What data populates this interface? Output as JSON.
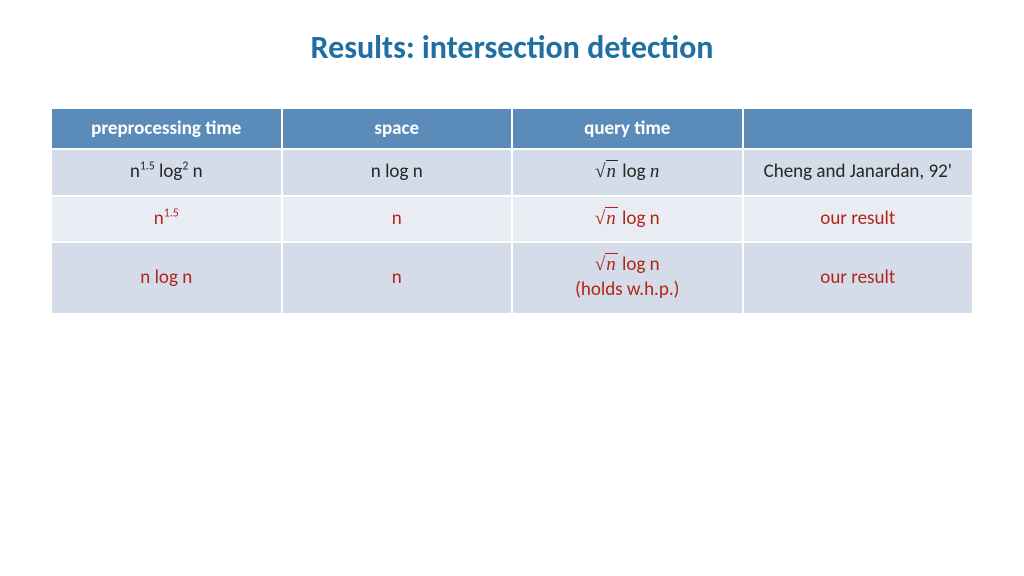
{
  "title": "Results: intersection detection",
  "colors": {
    "accent": "#1f6fa3",
    "header_bg": "#5b8cb9",
    "row_bg": "#d3dce8",
    "row_alt_bg": "#e9edf3",
    "highlight": "#b32317"
  },
  "headers": [
    "preprocessing time",
    "space",
    "query time",
    ""
  ],
  "rows": [
    {
      "highlight": false,
      "preprocessing": "n^1.5 log^2 n",
      "space": "n log n",
      "query": "√n log n",
      "query_note": "",
      "ref": "Cheng and Janardan, 92'"
    },
    {
      "highlight": true,
      "preprocessing": "n^1.5",
      "space": "n",
      "query": "√n log n",
      "query_note": "",
      "ref": "our result"
    },
    {
      "highlight": true,
      "preprocessing": "n log n",
      "space": "n",
      "query": "√n log n",
      "query_note": "(holds w.h.p.)",
      "ref": "our result"
    }
  ]
}
